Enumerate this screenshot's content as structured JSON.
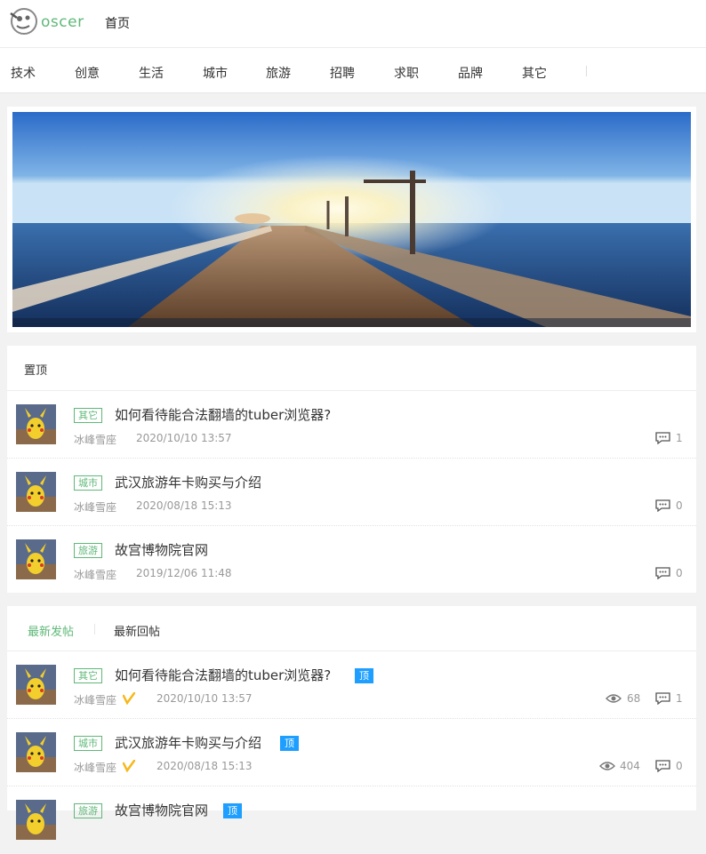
{
  "header": {
    "logo_text": "oscer",
    "home_link": "首页",
    "categories": [
      "技术",
      "创意",
      "生活",
      "城市",
      "旅游",
      "招聘",
      "求职",
      "品牌",
      "其它"
    ]
  },
  "pinned": {
    "title": "置顶",
    "items": [
      {
        "tag": "其它",
        "title": "如何看待能合法翻墙的tuber浏览器?",
        "author": "冰峰雪座",
        "time": "2020/10/10 13:57",
        "comments": "1"
      },
      {
        "tag": "城市",
        "title": "武汉旅游年卡购买与介绍",
        "author": "冰峰雪座",
        "time": "2020/08/18 15:13",
        "comments": "0"
      },
      {
        "tag": "旅游",
        "title": "故宫博物院官网",
        "author": "冰峰雪座",
        "time": "2019/12/06 11:48",
        "comments": "0"
      }
    ]
  },
  "latest": {
    "tab_new_posts": "最新发帖",
    "tab_new_replies": "最新回帖",
    "top_label": "顶",
    "items": [
      {
        "tag": "其它",
        "title": "如何看待能合法翻墙的tuber浏览器?",
        "author": "冰峰雪座",
        "time": "2020/10/10 13:57",
        "views": "68",
        "comments": "1"
      },
      {
        "tag": "城市",
        "title": "武汉旅游年卡购买与介绍",
        "author": "冰峰雪座",
        "time": "2020/08/18 15:13",
        "views": "404",
        "comments": "0"
      },
      {
        "tag": "旅游",
        "title": "故宫博物院官网",
        "author": "",
        "time": "",
        "views": "",
        "comments": ""
      }
    ]
  },
  "colors": {
    "accent": "#5fb878",
    "badge": "#1e9fff",
    "vip": "#f6b81a"
  }
}
